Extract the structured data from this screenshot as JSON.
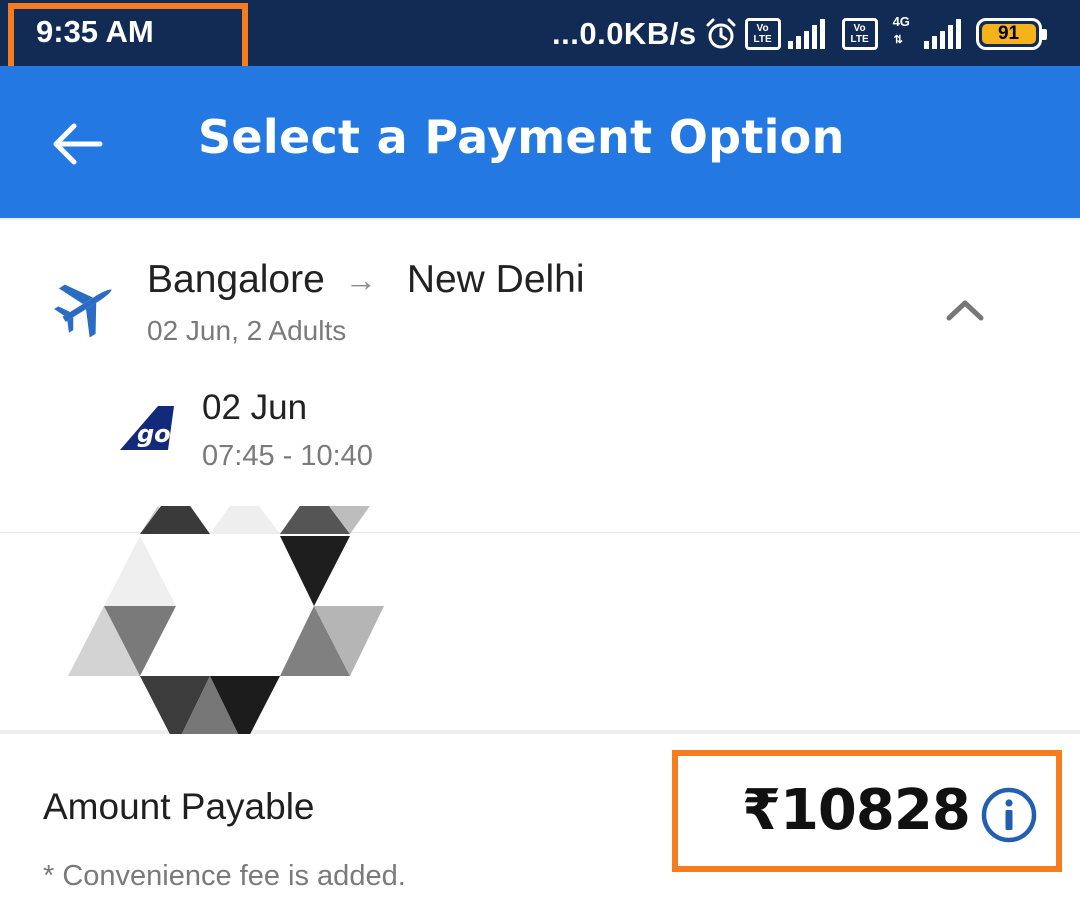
{
  "status_bar": {
    "time": "9:35 AM",
    "net_speed": "...0.0KB/s",
    "volte_label_top": "Vo",
    "volte_label_bottom": "LTE",
    "network_type": "4G",
    "battery_level": "91",
    "icons": [
      "alarm-icon",
      "volte-icon",
      "signal-icon",
      "volte-icon",
      "signal-icon",
      "battery-icon"
    ]
  },
  "header": {
    "title": "Select a Payment Option",
    "back_icon": "back-arrow-icon"
  },
  "trip": {
    "origin": "Bangalore",
    "destination": "New Delhi",
    "meta": "02 Jun, 2 Adults",
    "icon": "plane-icon",
    "collapse_icon": "chevron-up-icon",
    "flight": {
      "airline_logo": "airline-logo-icon",
      "date": "02 Jun",
      "time": "07:45 - 10:40"
    }
  },
  "payment": {
    "label": "Amount Payable",
    "amount": "₹10828",
    "note": "* Convenience fee is added.",
    "info_icon": "info-icon"
  },
  "colors": {
    "status_bar": "#122b54",
    "app_bar": "#2379e1",
    "highlight": "#f57c1f",
    "battery": "#f6b21b"
  }
}
